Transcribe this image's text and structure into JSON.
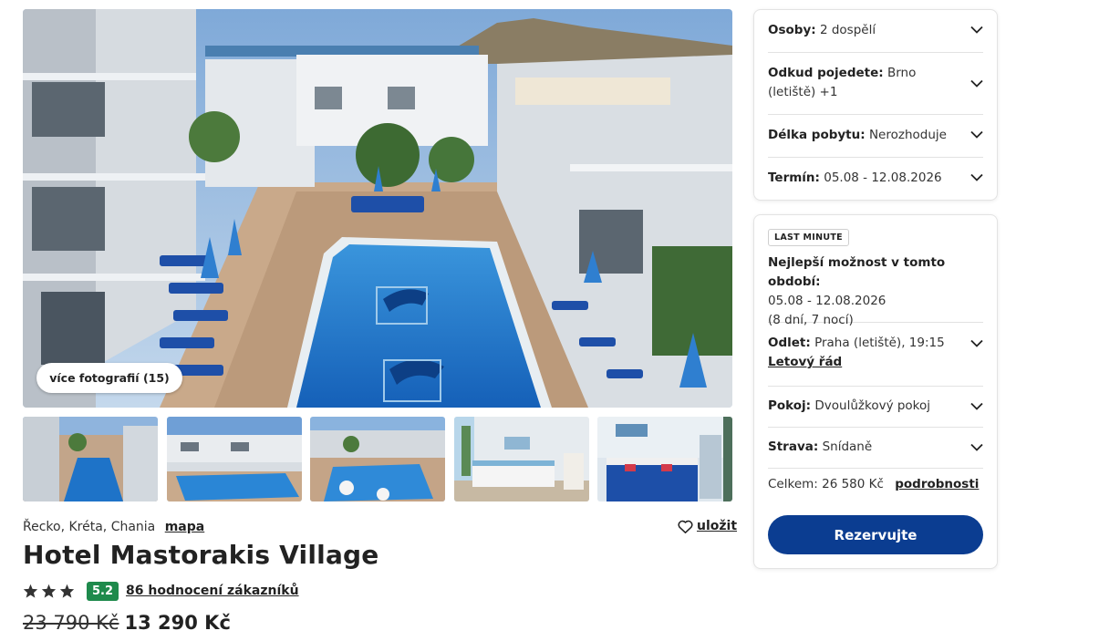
{
  "gallery": {
    "more_photos_label": "více fotografií (15)"
  },
  "hotel": {
    "location": "Řecko, Kréta, Chania",
    "map_label": "mapa",
    "save_label": "uložit",
    "name": "Hotel Mastorakis Village",
    "stars": 3,
    "score": "5.2",
    "reviews_label": "86 hodnocení zákazníků",
    "old_price": "23 790 Kč",
    "new_price": "13 290 Kč"
  },
  "filters": {
    "persons_label": "Osoby:",
    "persons_value": "2 dospělí",
    "departure_label": "Odkud pojedete:",
    "departure_value": "Brno",
    "departure_value_2": "(letiště) +1",
    "length_label": "Délka pobytu:",
    "length_value": "Nerozhoduje",
    "term_label": "Termín:",
    "term_value": "05.08 - 12.08.2026"
  },
  "offer": {
    "badge": "LAST MINUTE",
    "best_label": "Nejlepší možnost v tomto období:",
    "dates": "05.08 - 12.08.2026",
    "nights": "(8 dní, 7 nocí)",
    "flight_label": "Odlet:",
    "flight_value": "Praha (letiště), 19:15",
    "schedule_link": "Letový řád",
    "room_label": "Pokoj:",
    "room_value": "Dvoulůžkový pokoj",
    "board_label": "Strava:",
    "board_value": "Snídaně",
    "total_label": "Celkem: 26 580 Kč",
    "details_link": "podrobnosti",
    "book_label": "Rezervujte"
  },
  "colors": {
    "primary": "#0b3d91",
    "score_badge": "#1e8a4c",
    "pool": "#1f78c8"
  }
}
